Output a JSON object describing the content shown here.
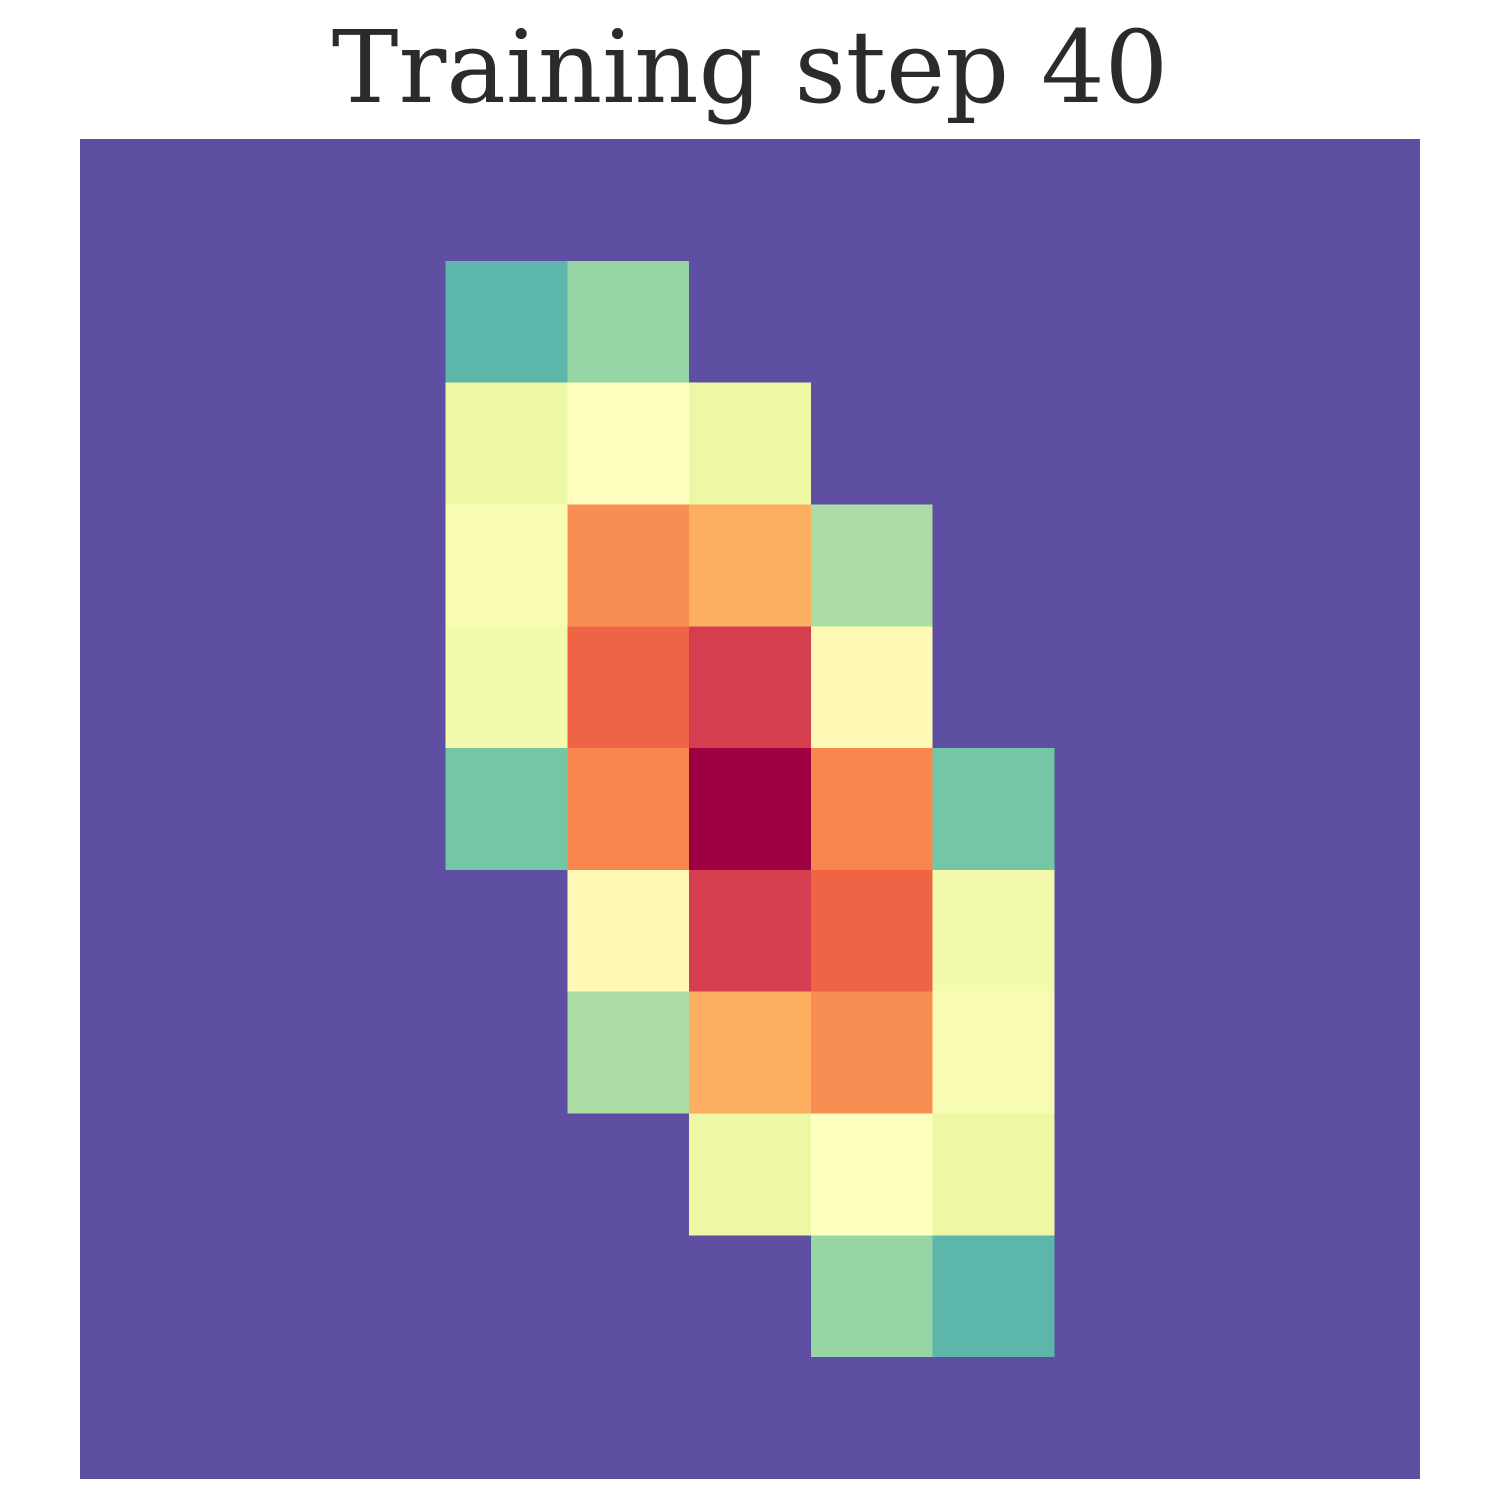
{
  "chart_data": {
    "type": "heatmap",
    "title": "Training step 40",
    "xlabel": "",
    "ylabel": "",
    "colormap": "Spectral_r",
    "value_range": [
      0,
      1
    ],
    "grid": false,
    "rows": 11,
    "cols": 11,
    "values": [
      [
        0,
        0,
        0,
        0,
        0,
        0,
        0,
        0,
        0,
        0,
        0
      ],
      [
        0,
        0,
        0,
        0.18,
        0.27,
        0,
        0,
        0,
        0,
        0,
        0
      ],
      [
        0,
        0,
        0,
        0.43,
        0.5,
        0.43,
        0,
        0,
        0,
        0,
        0
      ],
      [
        0,
        0,
        0,
        0.47,
        0.75,
        0.7,
        0.3,
        0,
        0,
        0,
        0
      ],
      [
        0,
        0,
        0,
        0.45,
        0.82,
        0.9,
        0.52,
        0,
        0,
        0,
        0
      ],
      [
        0,
        0,
        0,
        0.22,
        0.76,
        1.0,
        0.76,
        0.22,
        0,
        0,
        0
      ],
      [
        0,
        0,
        0,
        0,
        0.52,
        0.9,
        0.82,
        0.45,
        0,
        0,
        0
      ],
      [
        0,
        0,
        0,
        0,
        0.3,
        0.7,
        0.75,
        0.47,
        0,
        0,
        0
      ],
      [
        0,
        0,
        0,
        0,
        0,
        0.43,
        0.5,
        0.43,
        0,
        0,
        0
      ],
      [
        0,
        0,
        0,
        0,
        0,
        0,
        0.27,
        0.18,
        0,
        0,
        0
      ],
      [
        0,
        0,
        0,
        0,
        0,
        0,
        0,
        0,
        0,
        0,
        0
      ]
    ]
  }
}
